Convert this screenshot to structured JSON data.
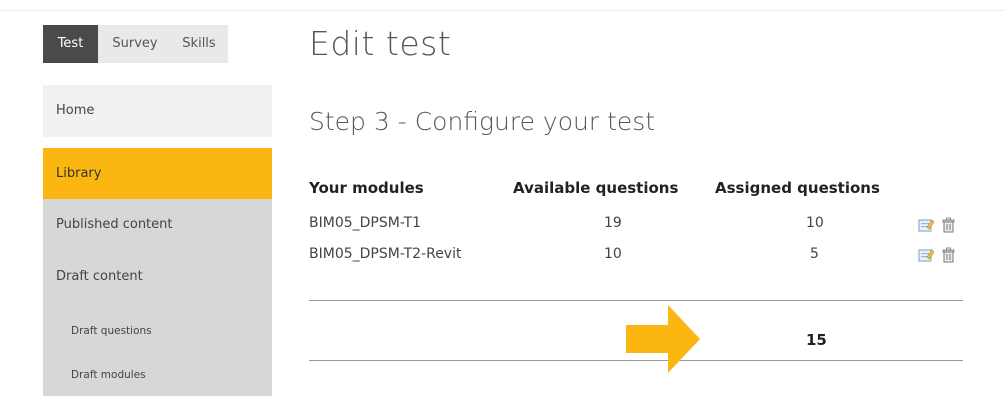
{
  "tabs": [
    {
      "label": "Test",
      "active": true
    },
    {
      "label": "Survey",
      "active": false
    },
    {
      "label": "Skills",
      "active": false
    }
  ],
  "sidebar": {
    "items": [
      {
        "label": "Home"
      },
      {
        "label": "Library",
        "active": true
      },
      {
        "label": "Published content"
      },
      {
        "label": "Draft content"
      },
      {
        "label": "Draft questions",
        "sub": true
      },
      {
        "label": "Draft modules",
        "sub": true
      }
    ]
  },
  "page": {
    "title": "Edit test",
    "step_title": "Step 3 - Configure your test"
  },
  "table": {
    "headers": [
      "Your modules",
      "Available questions",
      "Assigned questions"
    ],
    "rows": [
      {
        "module": "BIM05_DPSM-T1",
        "available": "19",
        "assigned": "10"
      },
      {
        "module": "BIM05_DPSM-T2-Revit",
        "available": "10",
        "assigned": "5"
      }
    ],
    "total_assigned": "15"
  },
  "icons": [
    "edit-icon",
    "delete-icon"
  ],
  "colors": {
    "accent": "#fbb611",
    "active_tab": "#4a4a4a",
    "sidebar_gray": "#d7d7d7"
  }
}
